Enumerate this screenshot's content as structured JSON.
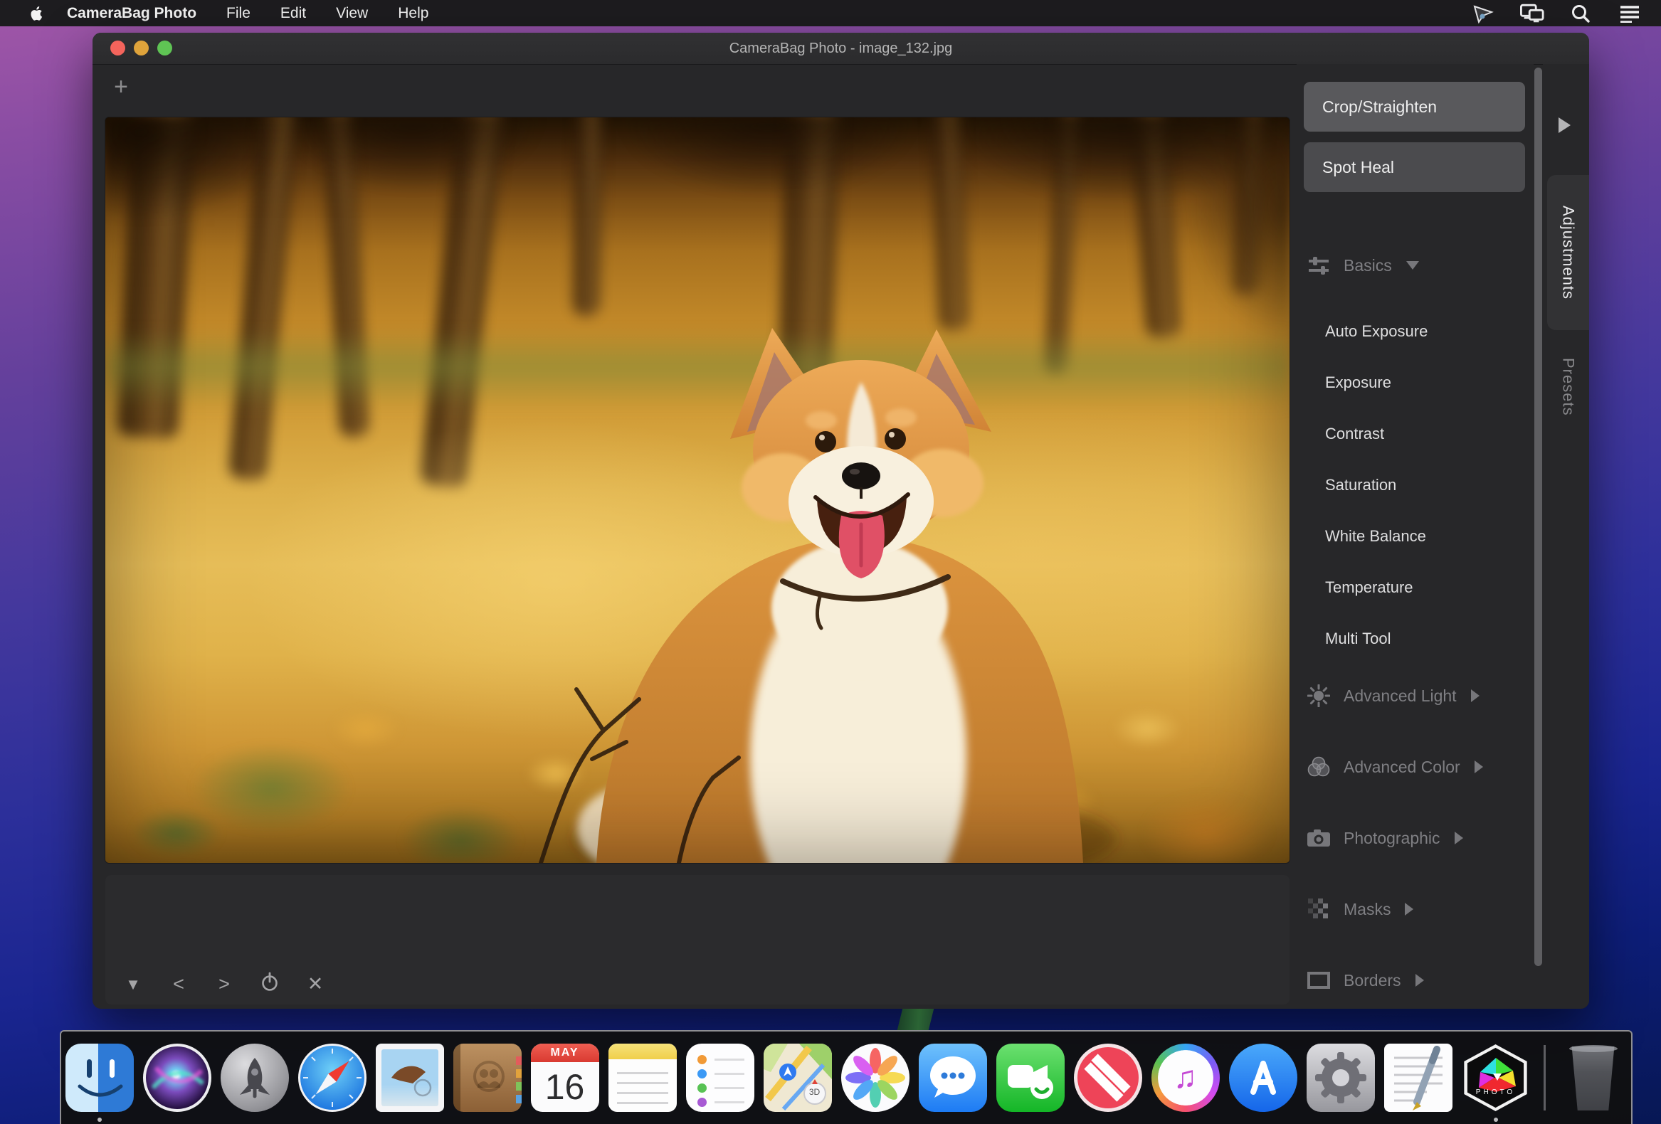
{
  "menubar": {
    "apple_logo": "apple-icon",
    "app_name": "CameraBag Photo",
    "items": [
      "File",
      "Edit",
      "View",
      "Help"
    ],
    "status_icons": [
      "pointer-icon",
      "displays-icon",
      "spotlight-icon",
      "list-icon"
    ]
  },
  "window": {
    "title": "CameraBag Photo - image_132.jpg"
  },
  "main": {
    "add_label": "+"
  },
  "filmstrip": {
    "icons": {
      "collapse": "▼",
      "prev": "<",
      "next": ">",
      "close": "✕"
    }
  },
  "sidebar": {
    "tools": [
      {
        "label": "Crop/Straighten"
      },
      {
        "label": "Spot Heal"
      }
    ],
    "sections": [
      {
        "label": "Basics",
        "icon": "sliders-icon",
        "state": "expanded",
        "items": [
          "Auto Exposure",
          "Exposure",
          "Contrast",
          "Saturation",
          "White Balance",
          "Temperature",
          "Multi Tool"
        ]
      },
      {
        "label": "Advanced Light",
        "icon": "sun-icon",
        "state": "collapsed"
      },
      {
        "label": "Advanced Color",
        "icon": "color-circles-icon",
        "state": "collapsed"
      },
      {
        "label": "Photographic",
        "icon": "camera-icon",
        "state": "collapsed"
      },
      {
        "label": "Masks",
        "icon": "checker-icon",
        "state": "collapsed"
      },
      {
        "label": "Borders",
        "icon": "border-icon",
        "state": "collapsed"
      }
    ],
    "tabs": [
      {
        "label": "Adjustments",
        "active": true
      },
      {
        "label": "Presets",
        "active": false
      }
    ]
  },
  "dock": {
    "apps": [
      "Finder",
      "Siri",
      "Launchpad",
      "Safari",
      "Mail",
      "Contacts",
      "Calendar",
      "Notes",
      "Reminders",
      "Maps",
      "Photos",
      "Messages",
      "FaceTime",
      "News",
      "iTunes",
      "App Store",
      "System Preferences",
      "TextEdit",
      "CameraBag Photo",
      "Trash"
    ],
    "running": [
      "Finder",
      "CameraBag Photo"
    ],
    "calendar": {
      "month": "MAY",
      "day": "16"
    },
    "maps_3d": "3D",
    "camerabag_label": "PHOTO"
  },
  "colors": {
    "window_bg": "#272729",
    "titlebar_bg": "#2d2d2f",
    "button_highlight": "#59595c",
    "button_normal": "#4b4b4e",
    "accent_text": "#dededf",
    "dim_text": "#7f7f83",
    "traffic_red": "#f4645c",
    "traffic_yellow": "#dfa33b",
    "traffic_green": "#5fc454"
  }
}
